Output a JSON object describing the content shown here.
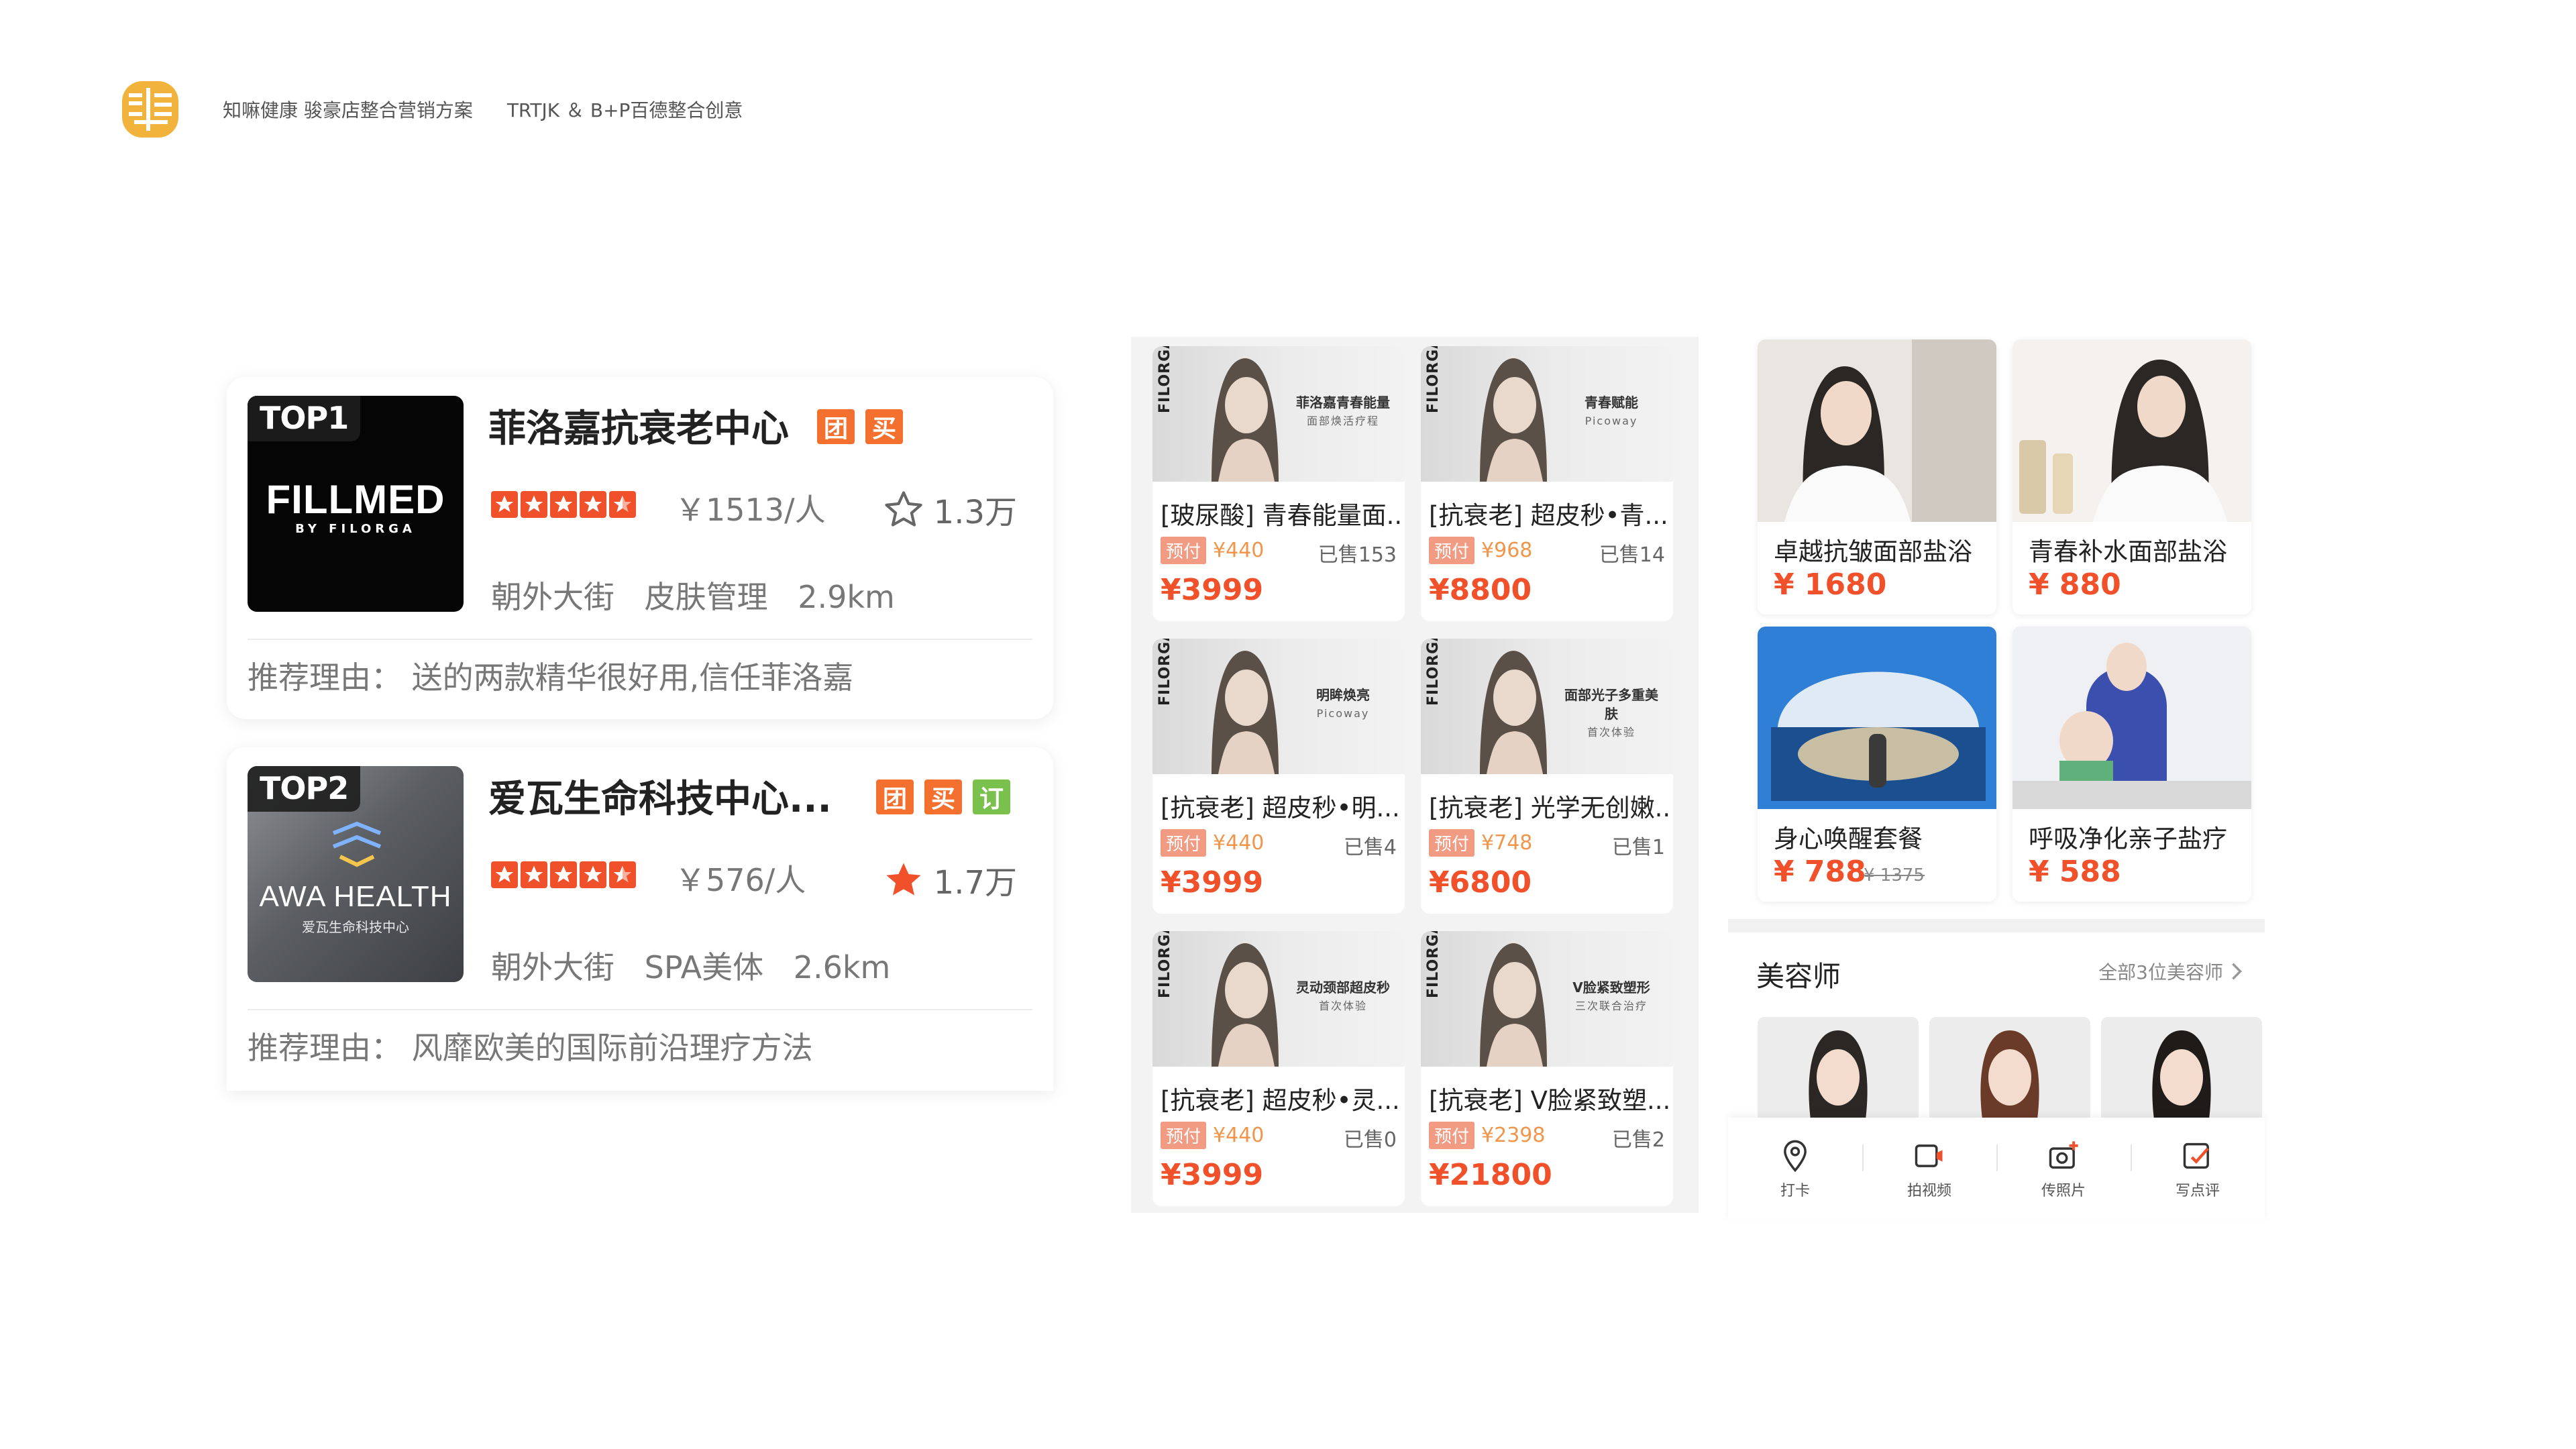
{
  "header": {
    "title": "知嘛健康 骏豪店整合营销方案",
    "partner": "TRTJK ＆ B+P百德整合创意"
  },
  "ranking": [
    {
      "badge": "TOP1",
      "brand": "FILLMED",
      "brand_sub": "BY FILORGA",
      "name": "菲洛嘉抗衰老中心",
      "tags": [
        "团",
        "买"
      ],
      "rating_stars": 4.5,
      "price": "￥1513/人",
      "favorites": "1.3万",
      "favorited": false,
      "street": "朝外大街",
      "category": "皮肤管理",
      "distance": "2.9km",
      "reason": "推荐理由：  送的两款精华很好用,信任菲洛嘉"
    },
    {
      "badge": "TOP2",
      "brand": "AWA HEALTH",
      "brand_sub": "爱瓦生命科技中心",
      "name": "爱瓦生命科技中心...",
      "tags": [
        "团",
        "买",
        "订"
      ],
      "rating_stars": 4.5,
      "price": "￥576/人",
      "favorites": "1.7万",
      "favorited": true,
      "street": "朝外大街",
      "category": "SPA美体",
      "distance": "2.6km",
      "reason": "推荐理由：  风靡欧美的国际前沿理疗方法"
    }
  ],
  "products": [
    {
      "brand": "FILORGA",
      "caption": "菲洛嘉青春能量",
      "caption2": "面部焕活疗程",
      "title": "[玻尿酸] 青春能量面...",
      "pre_label": "预付",
      "pre_price": "¥440",
      "sold": "已售153",
      "price": "¥3999"
    },
    {
      "brand": "FILORGA",
      "caption": "青春赋能",
      "caption2": "Picoway",
      "title": "[抗衰老] 超皮秒•青...",
      "pre_label": "预付",
      "pre_price": "¥968",
      "sold": "已售14",
      "price": "¥8800"
    },
    {
      "brand": "FILORGA",
      "caption": "明眸焕亮",
      "caption2": "Picoway",
      "title": "[抗衰老] 超皮秒•明...",
      "pre_label": "预付",
      "pre_price": "¥440",
      "sold": "已售4",
      "price": "¥3999"
    },
    {
      "brand": "FILORGA",
      "caption": "面部光子多重美肤",
      "caption2": "首次体验",
      "title": "[抗衰老] 光学无创嫩...",
      "pre_label": "预付",
      "pre_price": "¥748",
      "sold": "已售1",
      "price": "¥6800"
    },
    {
      "brand": "FILORGA",
      "caption": "灵动颈部超皮秒",
      "caption2": "首次体验",
      "title": "[抗衰老] 超皮秒•灵...",
      "pre_label": "预付",
      "pre_price": "¥440",
      "sold": "已售0",
      "price": "¥3999"
    },
    {
      "brand": "FILORGA",
      "caption": "V脸紧致塑形",
      "caption2": "三次联合治疗",
      "title": "[抗衰老] V脸紧致塑...",
      "pre_label": "预付",
      "pre_price": "¥2398",
      "sold": "已售2",
      "price": "¥21800"
    }
  ],
  "services": [
    {
      "name": "卓越抗皱面部盐浴",
      "price": "¥ 1680",
      "old_price": ""
    },
    {
      "name": "青春补水面部盐浴",
      "price": "¥ 880",
      "old_price": ""
    },
    {
      "name": "身心唤醒套餐",
      "price": "¥ 788",
      "old_price": "¥ 1375"
    },
    {
      "name": "呼吸净化亲子盐疗",
      "price": "¥ 588",
      "old_price": ""
    }
  ],
  "beauticians": {
    "title": "美容师",
    "all_link": "全部3位美容师"
  },
  "actions": [
    {
      "label": "打卡",
      "icon": "location-pin-icon"
    },
    {
      "label": "拍视频",
      "icon": "video-icon"
    },
    {
      "label": "传照片",
      "icon": "camera-icon"
    },
    {
      "label": "写点评",
      "icon": "edit-review-icon"
    }
  ],
  "colors": {
    "accent": "#f0512a",
    "tag_orange": "#f4702f",
    "tag_green": "#79c14c",
    "logo_gold": "#f2b33d"
  }
}
